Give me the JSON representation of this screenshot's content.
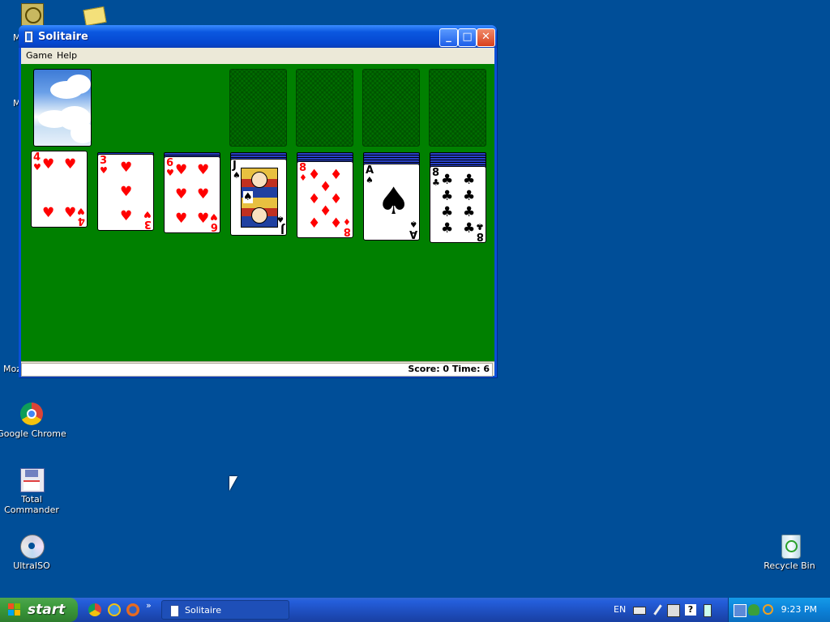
{
  "window": {
    "title": "Solitaire",
    "menu": [
      "Game",
      "Help"
    ],
    "buttons": {
      "minimize": "_",
      "maximize": "□",
      "close": "✕"
    },
    "status": "Score: 0 Time: 6"
  },
  "game": {
    "tableau": [
      {
        "rank": "4",
        "suit": "♥",
        "color": "red"
      },
      {
        "rank": "3",
        "suit": "♥",
        "color": "red"
      },
      {
        "rank": "6",
        "suit": "♥",
        "color": "red"
      },
      {
        "rank": "J",
        "suit": "♠",
        "color": "black"
      },
      {
        "rank": "8",
        "suit": "♦",
        "color": "red"
      },
      {
        "rank": "A",
        "suit": "♠",
        "color": "black"
      },
      {
        "rank": "8",
        "suit": "♣",
        "color": "black"
      }
    ]
  },
  "desktop": {
    "icons": [
      {
        "label": "Google Chrome"
      },
      {
        "label": "Total Commander"
      },
      {
        "label": "UltraISO"
      },
      {
        "label": "Recycle Bin"
      }
    ],
    "partial_labels": [
      "M",
      "M",
      "Moz"
    ]
  },
  "taskbar": {
    "start_label": "start",
    "task": "Solitaire",
    "lang": "EN",
    "time": "9:23 PM"
  }
}
